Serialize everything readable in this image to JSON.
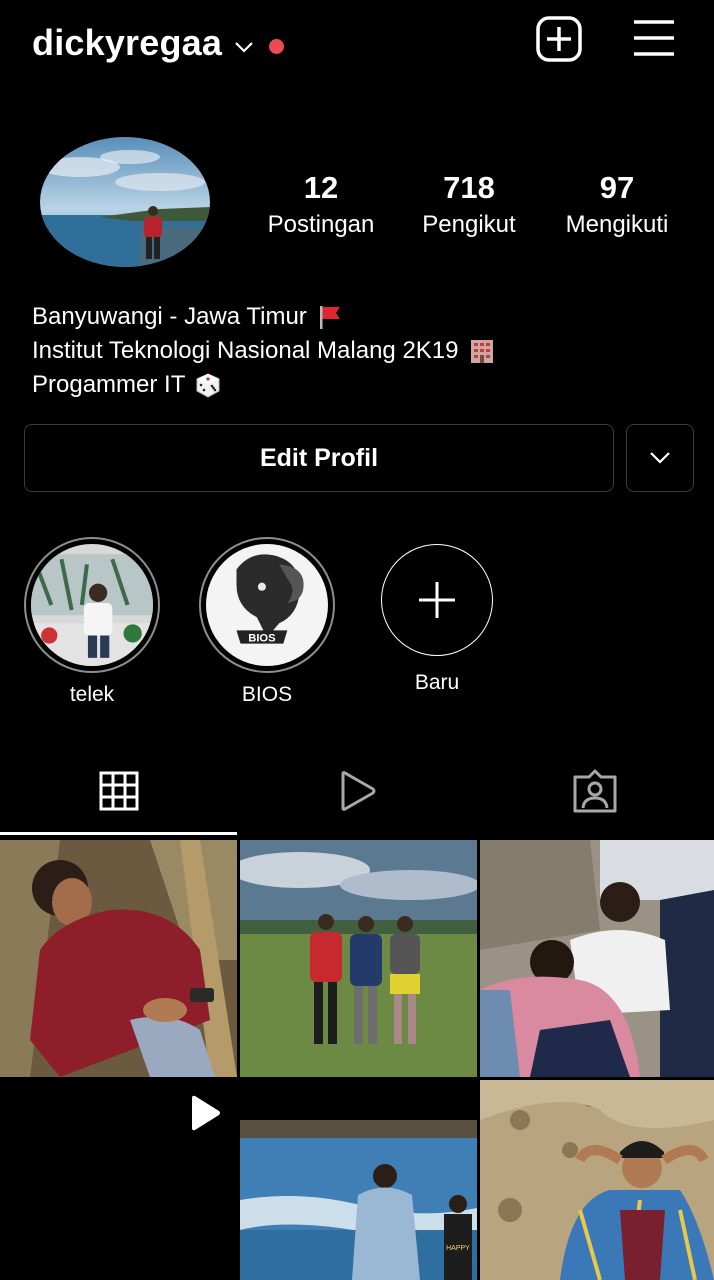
{
  "header": {
    "username": "dickyregaa"
  },
  "profile": {
    "stats": [
      {
        "value": "12",
        "label": "Postingan"
      },
      {
        "value": "718",
        "label": "Pengikut"
      },
      {
        "value": "97",
        "label": "Mengikuti"
      }
    ],
    "bio": [
      {
        "text": "Banyuwangi - Jawa Timur",
        "emoji": "red-flag-icon"
      },
      {
        "text": "Institut Teknologi Nasional Malang 2K19",
        "emoji": "office-building-icon"
      },
      {
        "text": "Progammer IT",
        "emoji": "game-die-icon"
      }
    ]
  },
  "actions": {
    "edit_profile": "Edit Profil"
  },
  "highlights": [
    {
      "label": "telek"
    },
    {
      "label": "BIOS"
    },
    {
      "label": "Baru"
    }
  ],
  "tabs": [
    {
      "icon": "grid-icon",
      "active": true
    },
    {
      "icon": "reels-play-icon",
      "active": false
    },
    {
      "icon": "tagged-person-icon",
      "active": false
    }
  ],
  "colors": {
    "background": "#000000",
    "text": "#ffffff",
    "live_dot": "#ed4956",
    "border": "#3a3a3a"
  }
}
